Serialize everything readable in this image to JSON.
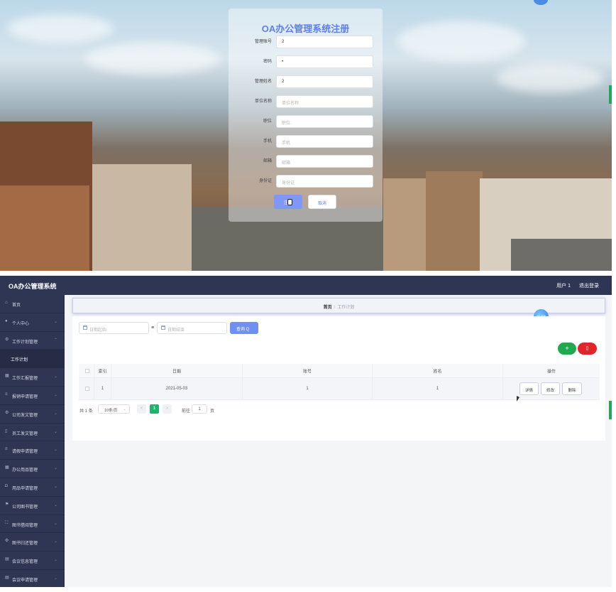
{
  "register": {
    "title": "OA办公管理系统注册",
    "fields": [
      {
        "label": "管理账号",
        "value": "2",
        "placeholder": ""
      },
      {
        "label": "密码",
        "value": "•",
        "placeholder": ""
      },
      {
        "label": "管理姓名",
        "value": "2",
        "placeholder": ""
      },
      {
        "label": "单位名称",
        "value": "",
        "placeholder": "单位名称"
      },
      {
        "label": "职位",
        "value": "",
        "placeholder": "职位"
      },
      {
        "label": "手机",
        "value": "",
        "placeholder": "手机"
      },
      {
        "label": "邮箱",
        "value": "",
        "placeholder": "邮箱"
      },
      {
        "label": "身份证",
        "value": "",
        "placeholder": "身份证"
      }
    ],
    "submit_label": "注册",
    "cancel_label": "取消"
  },
  "admin": {
    "brand": "OA办公管理系统",
    "user": "用户 1",
    "logout": "退出登录",
    "breadcrumb": {
      "home": "首页",
      "sep": "/",
      "current": "工作计划"
    },
    "time_badge": "01:58",
    "sidebar": [
      {
        "label": "首页",
        "icon": "home-icon",
        "sub": false
      },
      {
        "label": "个人中心",
        "icon": "user-icon",
        "sub": false
      },
      {
        "label": "工作计划管理",
        "icon": "gear-icon",
        "sub": false
      },
      {
        "label": "工作计划",
        "icon": "",
        "sub": true
      },
      {
        "label": "工作汇报管理",
        "icon": "grid-icon",
        "sub": false
      },
      {
        "label": "报销申请管理",
        "icon": "list-icon",
        "sub": false
      },
      {
        "label": "公司发文管理",
        "icon": "gear-icon",
        "sub": false
      },
      {
        "label": "员工发文管理",
        "icon": "phone-icon",
        "sub": false
      },
      {
        "label": "请假申请管理",
        "icon": "list-icon",
        "sub": false
      },
      {
        "label": "办公用品管理",
        "icon": "grid-icon",
        "sub": false
      },
      {
        "label": "用品申请管理",
        "icon": "lock-icon",
        "sub": false
      },
      {
        "label": "公司图书管理",
        "icon": "flag-icon",
        "sub": false
      },
      {
        "label": "图书借阅管理",
        "icon": "frame-icon",
        "sub": false
      },
      {
        "label": "图书归还管理",
        "icon": "gear-icon",
        "sub": false
      },
      {
        "label": "会议信息管理",
        "icon": "doc-icon",
        "sub": false
      },
      {
        "label": "会议申请管理",
        "icon": "doc-icon",
        "sub": false
      }
    ],
    "search": {
      "start_placeholder": "日期起始",
      "end_placeholder": "日期结束",
      "separator": "≡",
      "query_label": "查询 Q"
    },
    "add_label": "+",
    "delete_label": "▯",
    "table": {
      "columns": [
        "索引",
        "日期",
        "账号",
        "姓名",
        "操作"
      ],
      "rows": [
        {
          "index": "1",
          "date": "2021-05-03",
          "account": "1",
          "name": "1"
        }
      ],
      "actions": [
        "详情",
        "修改",
        "删除"
      ]
    },
    "pager": {
      "total": "共 1 条",
      "page_size": "10条/页",
      "prev": "<",
      "current": "1",
      "next": ">",
      "goto": "前往",
      "goto_value": "1",
      "page_unit": "页"
    }
  },
  "colors": {
    "sidebar": "#2f3654",
    "primary": "#6f8ff2",
    "success": "#20a94f",
    "danger": "#e0262b",
    "title": "#5e7ff0"
  }
}
